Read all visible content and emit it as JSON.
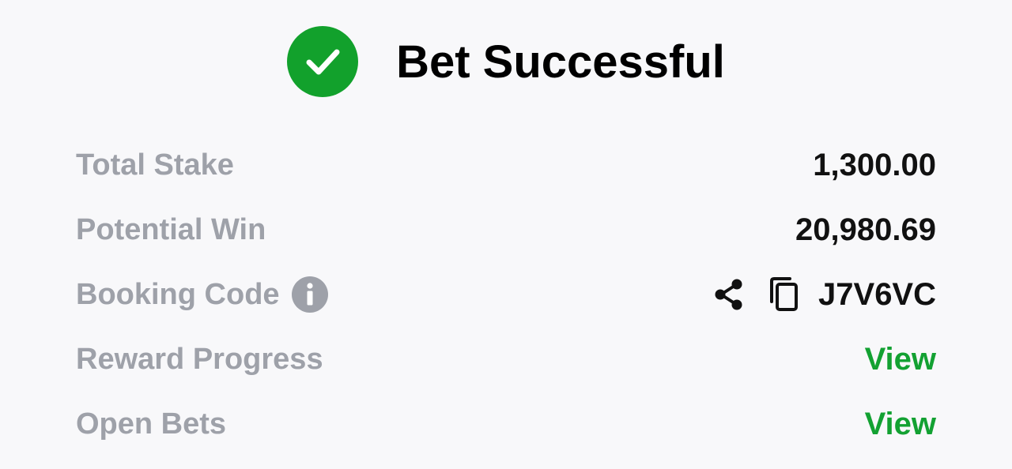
{
  "header": {
    "title": "Bet Successful",
    "icon": "check-circle-icon",
    "accent_color": "#12a12c"
  },
  "details": {
    "total_stake": {
      "label": "Total Stake",
      "value": "1,300.00"
    },
    "potential_win": {
      "label": "Potential Win",
      "value": "20,980.69"
    },
    "booking_code": {
      "label": "Booking Code",
      "info_icon": "info-icon",
      "share_icon": "share-icon",
      "copy_icon": "copy-icon",
      "value": "J7V6VC"
    },
    "reward_progress": {
      "label": "Reward Progress",
      "link": "View"
    },
    "open_bets": {
      "label": "Open Bets",
      "link": "View"
    }
  },
  "colors": {
    "label": "#9ea1a9",
    "value": "#111111",
    "link": "#13a132",
    "background": "#f8f8fa"
  }
}
